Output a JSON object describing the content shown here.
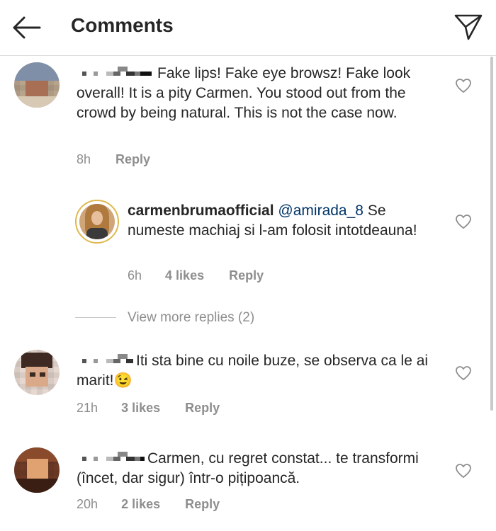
{
  "header": {
    "title": "Comments",
    "back_icon": "back-arrow-icon",
    "send_icon": "send-icon"
  },
  "comments": [
    {
      "text": "Fake lips! Fake eye browsz! Fake look overall! It is a pity Carmen. You stood out from the crowd  by being natural. This is not the case now.",
      "time": "8h",
      "likes": "",
      "reply": "Reply"
    },
    {
      "username": "carmenbrumaofficial",
      "mention": "@amirada_8",
      "text": "Se numeste machiaj si l-am folosit intotdeauna!",
      "time": "6h",
      "likes": "4 likes",
      "reply": "Reply"
    },
    {
      "text": "Iti sta bine cu noile buze, se observa ca le ai marit!😉",
      "time": "21h",
      "likes": "3 likes",
      "reply": "Reply"
    },
    {
      "text": "Carmen, cu regret constat... te transformi (încet, dar sigur) într-o pițipoancă.",
      "time": "20h",
      "likes": "2 likes",
      "reply": "Reply"
    }
  ],
  "view_more": "View more replies (2)",
  "colors": {
    "text": "#262626",
    "meta": "#8e8e8e",
    "mention": "#003569",
    "divider": "#dbdbdb"
  }
}
